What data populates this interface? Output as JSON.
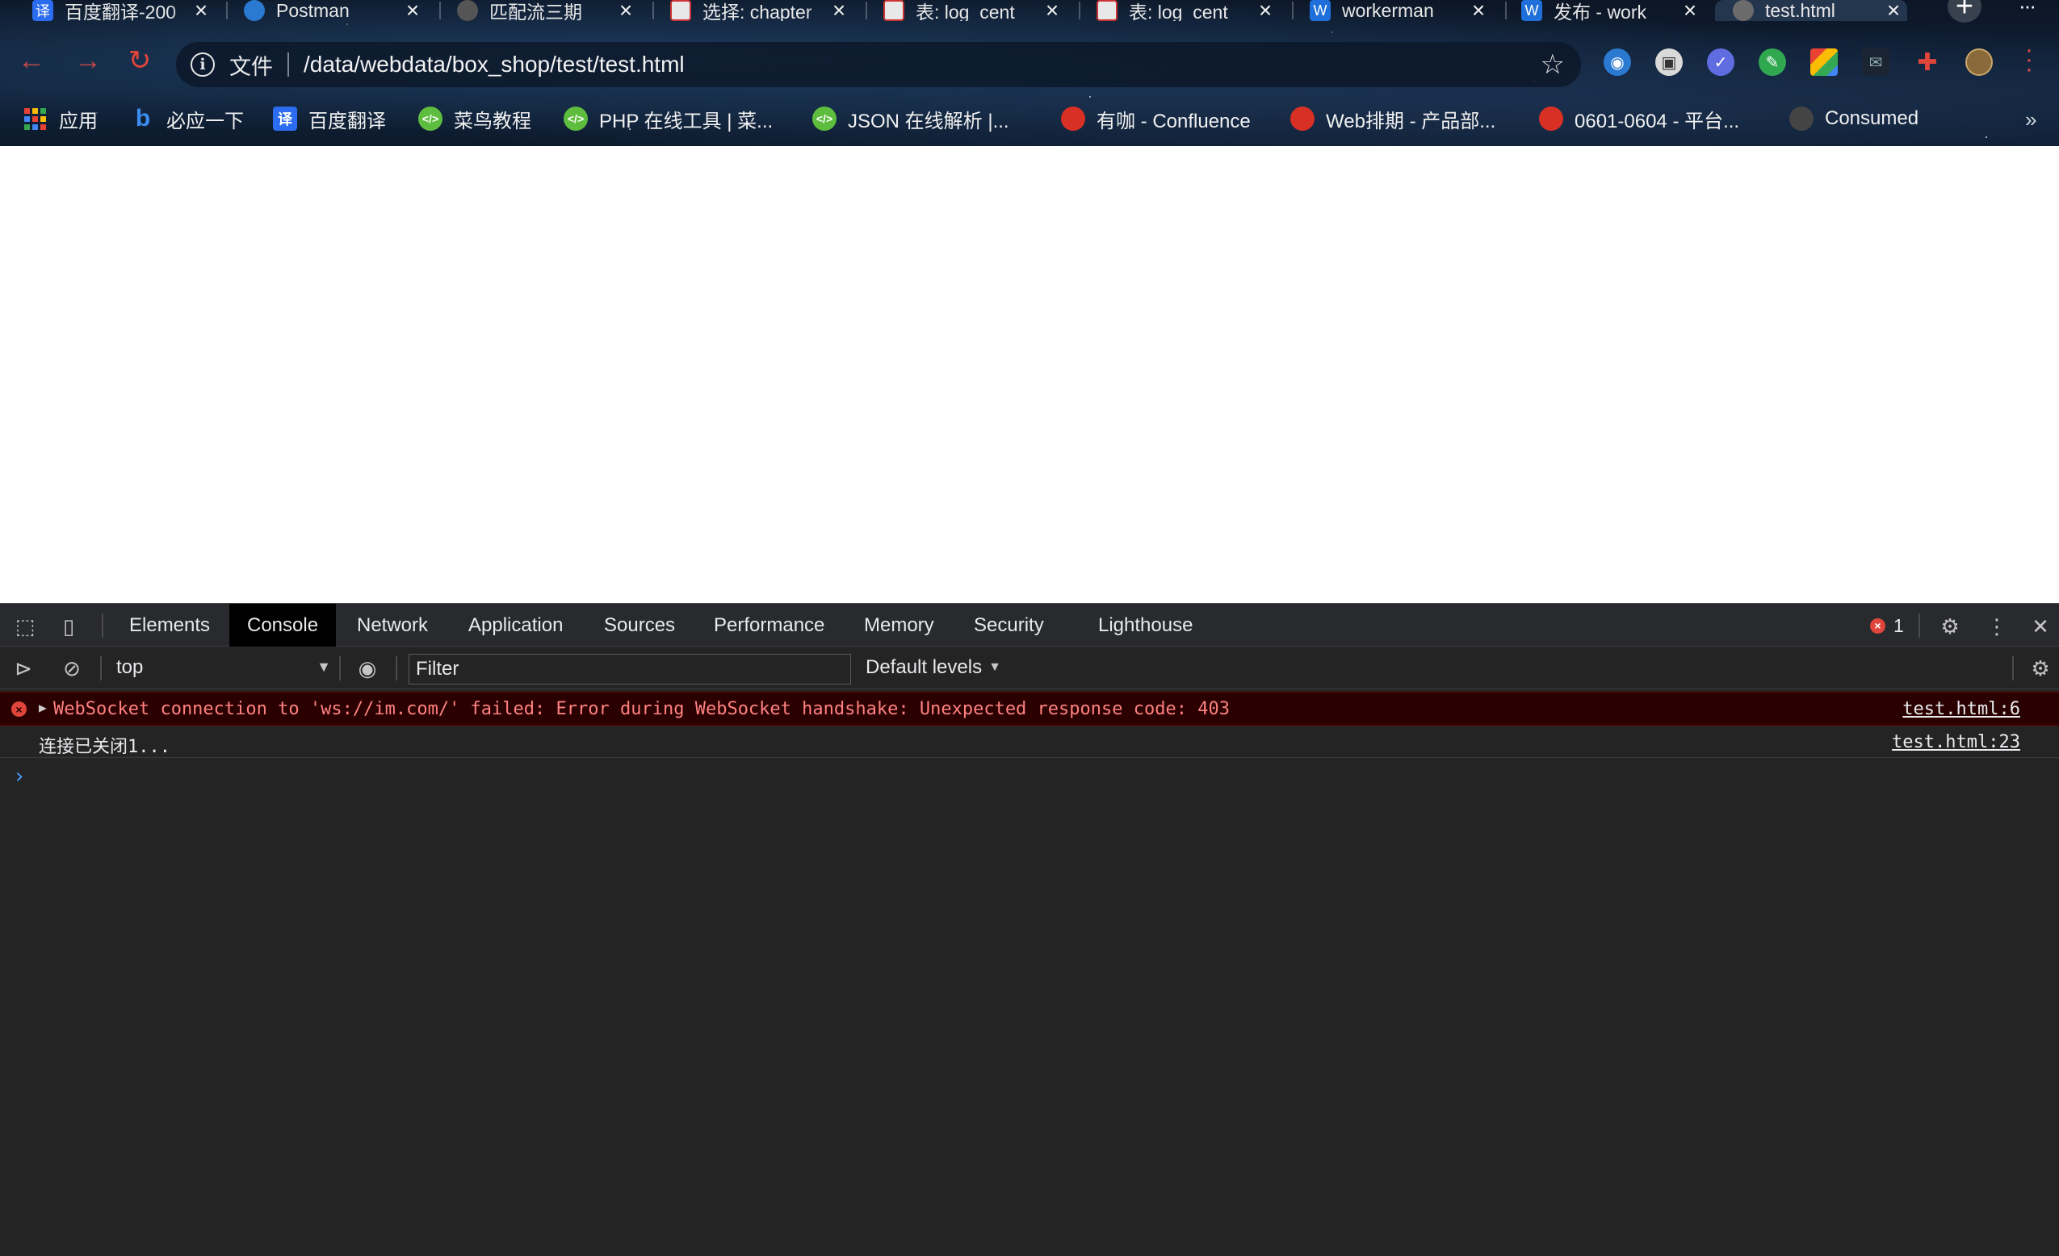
{
  "browser": {
    "tabs": [
      {
        "label": "百度翻译-200",
        "favicon": "translate-icon",
        "color": "#2b6cf0",
        "glyph": "译"
      },
      {
        "label": "Postman",
        "favicon": "globe-icon",
        "color": "#2b7ad1",
        "glyph": ""
      },
      {
        "label": "匹配流三期",
        "favicon": "page-icon",
        "color": "#666666",
        "glyph": ""
      },
      {
        "label": "选择: chapter",
        "favicon": "db-icon",
        "color": "#e8e8e8",
        "glyph": ""
      },
      {
        "label": "表: log_cent",
        "favicon": "db-icon",
        "color": "#e8e8e8",
        "glyph": ""
      },
      {
        "label": "表: log_cent",
        "favicon": "db-icon",
        "color": "#e8e8e8",
        "glyph": ""
      },
      {
        "label": "workerman",
        "favicon": "w-icon",
        "color": "#1e6fd9",
        "glyph": "W"
      },
      {
        "label": "发布 - work",
        "favicon": "w-icon",
        "color": "#1e6fd9",
        "glyph": "W"
      },
      {
        "label": "test.html",
        "favicon": "globe-icon",
        "color": "#8a8a8a",
        "glyph": "",
        "active": true
      }
    ],
    "new_tab": "+",
    "address": {
      "scheme_label": "文件",
      "url": "/data/webdata/box_shop/test/test.html"
    },
    "bookmarks": [
      {
        "label": "应用",
        "icon": "apps-grid-icon"
      },
      {
        "label": "必应一下",
        "icon": "bing-icon",
        "color": "#1d6fe8",
        "glyph": "b"
      },
      {
        "label": "百度翻译",
        "icon": "translate-icon",
        "color": "#2b6cf0",
        "glyph": "译"
      },
      {
        "label": "菜鸟教程",
        "icon": "runoob-icon",
        "color": "#5ebd3e",
        "glyph": "</>"
      },
      {
        "label": "PHP 在线工具 | 菜...",
        "icon": "runoob-icon",
        "color": "#5ebd3e",
        "glyph": "</>"
      },
      {
        "label": "JSON 在线解析 |...",
        "icon": "runoob-icon",
        "color": "#5ebd3e",
        "glyph": "</>"
      },
      {
        "label": "有咖 - Confluence",
        "icon": "confluence-icon",
        "color": "#d93025",
        "glyph": ""
      },
      {
        "label": "Web排期 - 产品部...",
        "icon": "confluence-icon",
        "color": "#d93025",
        "glyph": ""
      },
      {
        "label": "0601-0604 - 平台...",
        "icon": "confluence-icon",
        "color": "#d93025",
        "glyph": ""
      },
      {
        "label": "Consumed",
        "icon": "page-icon",
        "color": "#555555",
        "glyph": ""
      }
    ],
    "extensions": [
      "globe-ext-icon",
      "screenshot-ext-icon",
      "check-ext-icon",
      "evernote-ext-icon",
      "colors-ext-icon",
      "mail-ext-icon",
      "puzzle-ext-icon",
      "avatar-icon"
    ]
  },
  "devtools": {
    "tabs": [
      "Elements",
      "Console",
      "Network",
      "Application",
      "Sources",
      "Performance",
      "Memory",
      "Security",
      "Lighthouse"
    ],
    "active_tab": "Console",
    "error_count": "1",
    "context": "top",
    "filter_placeholder": "Filter",
    "levels": "Default levels",
    "messages": [
      {
        "level": "error",
        "text": "WebSocket connection to 'ws://im.com/' failed: Error during WebSocket handshake: Unexpected response code: 403",
        "source": "test.html:6"
      },
      {
        "level": "log",
        "text": "连接已关闭1...",
        "source": "test.html:23"
      }
    ],
    "prompt": "›"
  }
}
